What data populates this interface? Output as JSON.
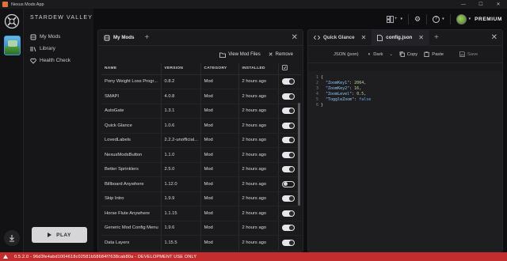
{
  "window": {
    "title": "Nexus Mods App",
    "controls": [
      "—",
      "☐",
      "✕"
    ]
  },
  "game": {
    "title": "STARDEW VALLEY",
    "play_label": "PLAY"
  },
  "nav": [
    {
      "label": "My Mods",
      "icon": "mods-icon"
    },
    {
      "label": "Library",
      "icon": "library-icon"
    },
    {
      "label": "Health Check",
      "icon": "health-check-icon"
    }
  ],
  "header": {
    "premium_label": "PREMIUM",
    "layout_icon": "+",
    "help_icon": "?"
  },
  "mods_panel": {
    "tab_label": "My Mods",
    "toolbar": {
      "view_files": "View Mod Files",
      "remove": "Remove"
    },
    "columns": {
      "name": "NAME",
      "version": "VERSION",
      "category": "CATEGORY",
      "installed": "INSTALLED"
    },
    "rows": [
      {
        "name": "Pony Weight Loss Progr...",
        "version": "0.8.2",
        "category": "Mod",
        "installed": "2 hours ago",
        "enabled": true
      },
      {
        "name": "SMAPI",
        "version": "4.0.8",
        "category": "Mod",
        "installed": "2 hours ago",
        "enabled": true
      },
      {
        "name": "AutoGate",
        "version": "1.3.1",
        "category": "Mod",
        "installed": "2 hours ago",
        "enabled": true
      },
      {
        "name": "Quick Glance",
        "version": "1.0.6",
        "category": "Mod",
        "installed": "2 hours ago",
        "enabled": true
      },
      {
        "name": "LovedLabels",
        "version": "2.2.2-unofficial...",
        "category": "Mod",
        "installed": "2 hours ago",
        "enabled": true
      },
      {
        "name": "NexusModsButton",
        "version": "1.1.0",
        "category": "Mod",
        "installed": "2 hours ago",
        "enabled": true
      },
      {
        "name": "Better Sprinklers",
        "version": "2.5.0",
        "category": "Mod",
        "installed": "2 hours ago",
        "enabled": true
      },
      {
        "name": "Billboard Anywhere",
        "version": "1.12.0",
        "category": "Mod",
        "installed": "2 hours ago",
        "enabled": false
      },
      {
        "name": "Skip Intro",
        "version": "1.9.9",
        "category": "Mod",
        "installed": "2 hours ago",
        "enabled": true
      },
      {
        "name": "Horse Flute Anywhere",
        "version": "1.1.15",
        "category": "Mod",
        "installed": "2 hours ago",
        "enabled": true
      },
      {
        "name": "Generic Mod Config Menu",
        "version": "1.9.6",
        "category": "Mod",
        "installed": "2 hours ago",
        "enabled": true
      },
      {
        "name": "Data Layers",
        "version": "1.15.5",
        "category": "Mod",
        "installed": "2 hours ago",
        "enabled": true
      }
    ]
  },
  "editor_panel": {
    "tabs": [
      {
        "label": "Quick Glance"
      },
      {
        "label": "config.json"
      }
    ],
    "toolbar": {
      "format": "JSON (json)",
      "theme": "Dark",
      "copy": "Copy",
      "paste": "Paste",
      "save": "Save"
    },
    "code_lines": [
      {
        "n": "1",
        "parts": [
          [
            "p",
            "{"
          ]
        ]
      },
      {
        "n": "2",
        "parts": [
          [
            "p",
            "  "
          ],
          [
            "k",
            "\"ZoomKey1\""
          ],
          [
            "p",
            ": "
          ],
          [
            "n",
            "2064"
          ],
          [
            "p",
            ","
          ]
        ]
      },
      {
        "n": "3",
        "parts": [
          [
            "p",
            "  "
          ],
          [
            "k",
            "\"ZoomKey2\""
          ],
          [
            "p",
            ": "
          ],
          [
            "n",
            "16"
          ],
          [
            "p",
            ","
          ]
        ]
      },
      {
        "n": "4",
        "parts": [
          [
            "p",
            "  "
          ],
          [
            "k",
            "\"ZoomLevel\""
          ],
          [
            "p",
            ": "
          ],
          [
            "n",
            "0.5"
          ],
          [
            "p",
            ","
          ]
        ]
      },
      {
        "n": "5",
        "parts": [
          [
            "p",
            "  "
          ],
          [
            "k",
            "\"ToggleZoom\""
          ],
          [
            "p",
            ": "
          ],
          [
            "b",
            "false"
          ]
        ]
      },
      {
        "n": "6",
        "parts": [
          [
            "p",
            "}"
          ]
        ]
      }
    ]
  },
  "footer": {
    "text": "0.5.2.0 - 96d3fe4abd1004618c02581b58684f7638cab80a - DEVELOPMENT USE ONLY"
  },
  "colors": {
    "accent_red": "#c42d2d",
    "background": "#0e0e10",
    "panel": "#1a1a1d"
  }
}
